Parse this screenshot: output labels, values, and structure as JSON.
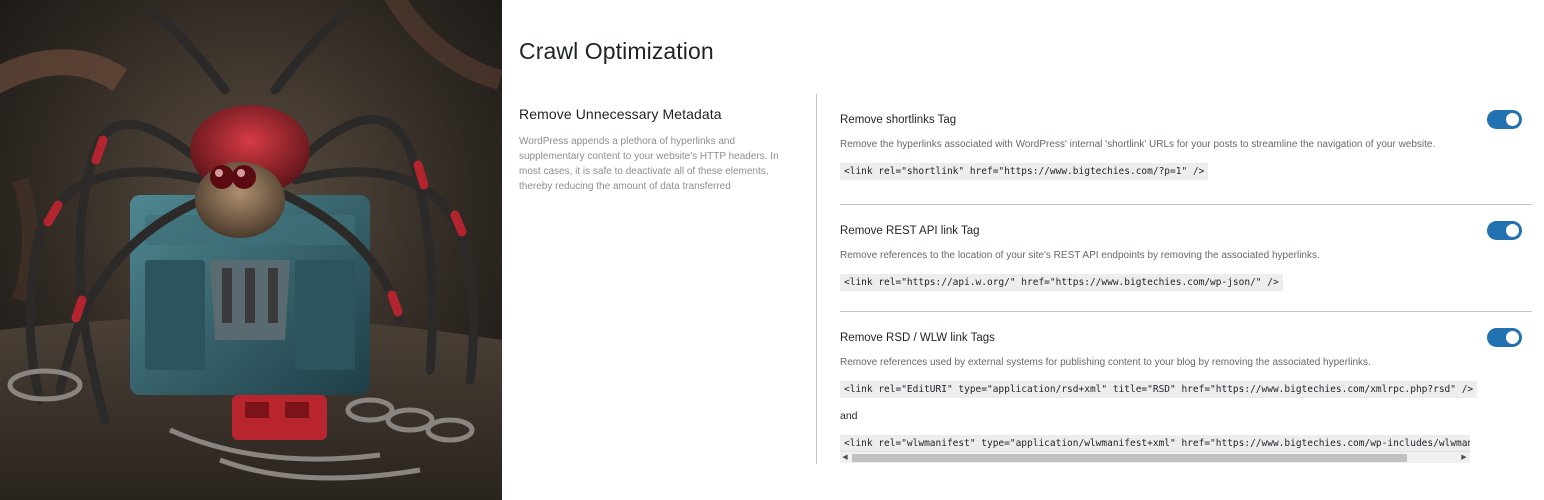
{
  "colors": {
    "accent": "#2271b1",
    "border": "#c3c4c7",
    "code_bg": "#ededed",
    "muted_text": "#8a8f94"
  },
  "hero": {
    "icon": "spider-on-box-illustration"
  },
  "page": {
    "title": "Crawl Optimization"
  },
  "section": {
    "title": "Remove Unnecessary Metadata",
    "description": "WordPress appends a plethora of hyperlinks and supplementary content to your website's HTTP headers. In most cases, it is safe to deactivate all of these elements, thereby reducing the amount of data transferred"
  },
  "options": [
    {
      "title": "Remove shortlinks Tag",
      "description": "Remove the hyperlinks associated with WordPress' internal 'shortlink' URLs for your posts to streamline the navigation of your website.",
      "code": "<link rel=\"shortlink\" href=\"https://www.bigtechies.com/?p=1\" />",
      "enabled": true
    },
    {
      "title": "Remove REST API link Tag",
      "description": "Remove references to the location of your site's REST API endpoints by removing the associated hyperlinks.",
      "code": "<link rel=\"https://api.w.org/\" href=\"https://www.bigtechies.com/wp-json/\" />",
      "enabled": true
    },
    {
      "title": "Remove RSD / WLW link Tags",
      "description": "Remove references used by external systems for publishing content to your blog by removing the associated hyperlinks.",
      "code": "<link rel=\"EditURI\" type=\"application/rsd+xml\" title=\"RSD\" href=\"https://www.bigtechies.com/xmlrpc.php?rsd\" />",
      "separator": "and",
      "code2": "<link rel=\"wlwmanifest\" type=\"application/wlwmanifest+xml\" href=\"https://www.bigtechies.com/wp-includes/wlwmanifest.xml\" />",
      "enabled": true
    }
  ]
}
